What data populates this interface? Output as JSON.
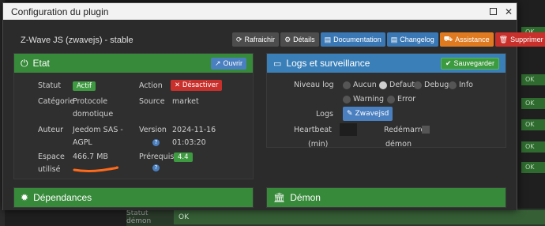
{
  "window": {
    "title": "Configuration du plugin"
  },
  "plugin": {
    "name": "Z-Wave JS (zwavejs) - stable"
  },
  "actions": [
    {
      "label": "Rafraichir",
      "icon": "refresh-icon",
      "style": "grey"
    },
    {
      "label": "Détails",
      "icon": "gear-icon",
      "style": "grey"
    },
    {
      "label": "Documentation",
      "icon": "book-icon",
      "style": "blue"
    },
    {
      "label": "Changelog",
      "icon": "book-icon",
      "style": "blue"
    },
    {
      "label": "Assistance",
      "icon": "truck-icon",
      "style": "orange"
    },
    {
      "label": "Supprimer",
      "icon": "trash-icon",
      "style": "red"
    }
  ],
  "etat": {
    "title": "Etat",
    "open_button": "Ouvrir",
    "statut_label": "Statut",
    "statut_value": "Actif",
    "action_label": "Action",
    "action_button": "Désactiver",
    "categorie_label": "Catégorie",
    "categorie_value_1": "Protocole",
    "categorie_value_2": "domotique",
    "source_label": "Source",
    "source_value": "market",
    "auteur_label": "Auteur",
    "auteur_value_1": "Jeedom SAS -",
    "auteur_value_2": "AGPL",
    "version_label": "Version",
    "version_value_1": "2024-11-16",
    "version_value_2": "01:03:20",
    "espace_label_1": "Espace",
    "espace_label_2": "utilisé",
    "espace_value": "466.7 MB",
    "prerequis_label": "Prérequis",
    "prerequis_value": "4.4"
  },
  "logs": {
    "title": "Logs et surveillance",
    "save_button": "Sauvegarder",
    "niveau_label": "Niveau log",
    "levels": [
      "Aucun",
      "Defaut",
      "Debug",
      "Info",
      "Warning",
      "Error"
    ],
    "selected_level": "Defaut",
    "logs_label": "Logs",
    "logs_button": "Zwavejsd",
    "heartbeat_label_1": "Heartbeat",
    "heartbeat_label_2": "(min)",
    "restart_label_1": "Redémarrer",
    "restart_label_2": "démon"
  },
  "dependances": {
    "title": "Dépendances"
  },
  "demon": {
    "title": "Démon"
  },
  "background": {
    "ok_label": "OK",
    "statut_demon_label": "Statut démon",
    "statut_demon_value": "OK"
  },
  "colors": {
    "green": "#378a3a",
    "blue": "#3a7fb8",
    "orange": "#e07a20",
    "red": "#c9302c"
  }
}
